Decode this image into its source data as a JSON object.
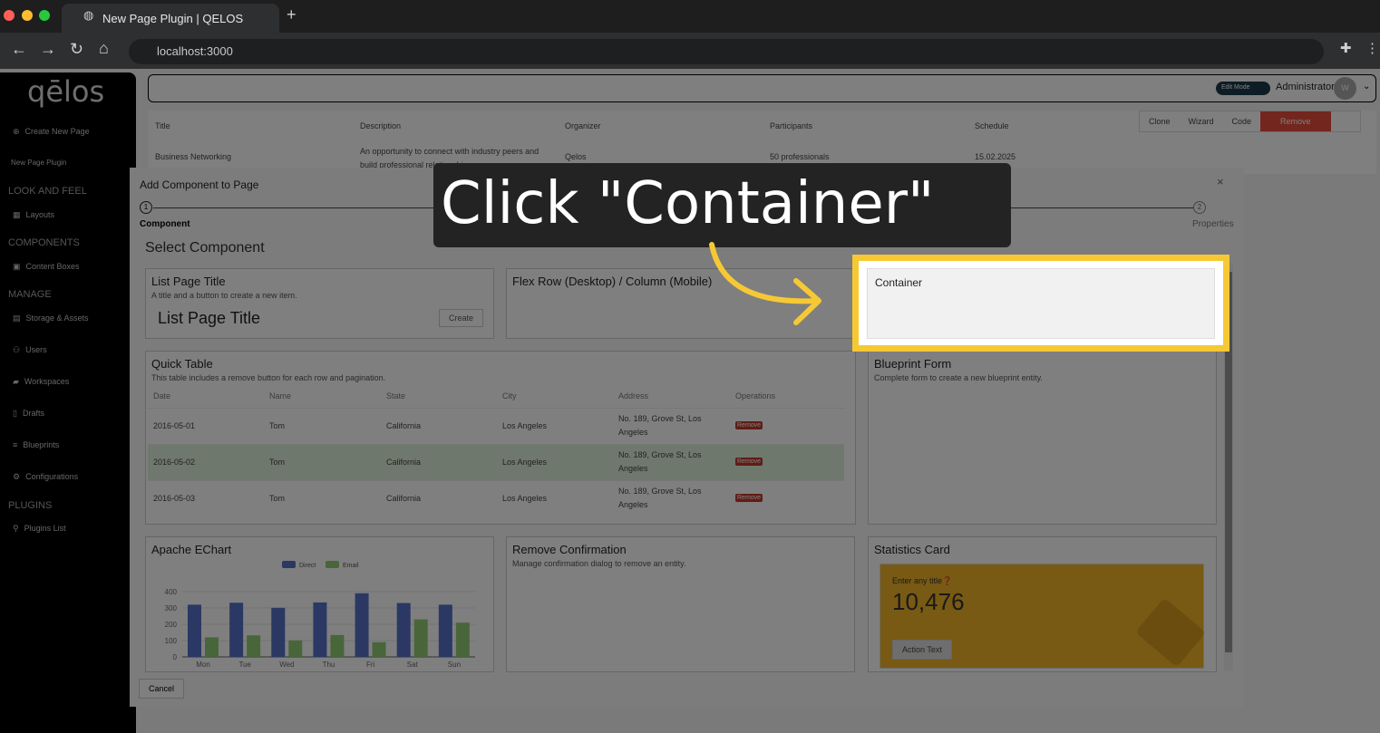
{
  "browser": {
    "tab_title": "New Page Plugin | QELOS",
    "url": "localhost:3000"
  },
  "sidebar": {
    "logo": "qēlos",
    "create": "Create New Page",
    "plugin": "New Page Plugin",
    "sections": [
      {
        "label": "LOOK AND FEEL"
      },
      {
        "label": "COMPONENTS"
      },
      {
        "label": "MANAGE"
      },
      {
        "label": "PLUGINS"
      }
    ],
    "items": [
      {
        "label": "Layouts",
        "icon": "grid-icon"
      },
      {
        "label": "Content Boxes",
        "icon": "box-icon"
      },
      {
        "label": "Storage & Assets",
        "icon": "storage-icon"
      },
      {
        "label": "Users",
        "icon": "users-icon"
      },
      {
        "label": "Workspaces",
        "icon": "briefcase-icon"
      },
      {
        "label": "Drafts",
        "icon": "document-icon"
      },
      {
        "label": "Blueprints",
        "icon": "database-icon"
      },
      {
        "label": "Configurations",
        "icon": "gear-icon"
      },
      {
        "label": "Plugins List",
        "icon": "plug-icon"
      }
    ]
  },
  "header": {
    "edit_mode": "Edit Mode",
    "user": "Administrator",
    "avatar": "W"
  },
  "toolbar": {
    "clone": "Clone",
    "wizard": "Wizard",
    "code": "Code",
    "remove": "Remove"
  },
  "bg_table": {
    "headers": [
      "Title",
      "Description",
      "Organizer",
      "Participants",
      "Schedule"
    ],
    "row": [
      "Business Networking",
      "An opportunity to connect with industry peers and build professional relationships",
      "Qelos",
      "50 professionals",
      "15.02.2025"
    ]
  },
  "modal": {
    "title": "Add Component to Page",
    "step1_num": "1",
    "step1": "Component",
    "step2_num": "2",
    "step2": "Properties",
    "heading": "Select Component",
    "cancel": "Cancel",
    "cards": {
      "list_title": {
        "title": "List Page Title",
        "desc": "A title and a button to create a new item.",
        "preview": "List Page Title",
        "button": "Create"
      },
      "flex": {
        "title": "Flex Row (Desktop) / Column (Mobile)"
      },
      "container": {
        "title": "Container"
      },
      "quick_table": {
        "title": "Quick Table",
        "desc": "This table includes a remove button for each row and pagination.",
        "headers": [
          "Date",
          "Name",
          "State",
          "City",
          "Address",
          "Operations"
        ],
        "rows": [
          [
            "2016-05-01",
            "Tom",
            "California",
            "Los Angeles",
            "No. 189, Grove St, Los Angeles",
            "Remove"
          ],
          [
            "2016-05-02",
            "Tom",
            "California",
            "Los Angeles",
            "No. 189, Grove St, Los Angeles",
            "Remove"
          ],
          [
            "2016-05-03",
            "Tom",
            "California",
            "Los Angeles",
            "No. 189, Grove St, Los Angeles",
            "Remove"
          ]
        ]
      },
      "blueprint": {
        "title": "Blueprint Form",
        "desc": "Complete form to create a new blueprint entity."
      },
      "echart": {
        "title": "Apache EChart"
      },
      "remove_conf": {
        "title": "Remove Confirmation",
        "desc": "Manage confirmation dialog to remove an entity."
      },
      "stats": {
        "title": "Statistics Card",
        "label": "Enter any title",
        "value": "10,476",
        "button": "Action Text",
        "color": "#f0b429"
      }
    }
  },
  "callout": {
    "text": "Click \"Container\"",
    "color": "#f6c934"
  },
  "chart_data": {
    "type": "bar",
    "categories": [
      "Mon",
      "Tue",
      "Wed",
      "Thu",
      "Fri",
      "Sat",
      "Sun"
    ],
    "series": [
      {
        "name": "Direct",
        "values": [
          320,
          332,
          301,
          334,
          390,
          330,
          320
        ],
        "color": "#5470c6"
      },
      {
        "name": "Email",
        "values": [
          120,
          132,
          101,
          134,
          90,
          230,
          210
        ],
        "color": "#91cc75"
      }
    ],
    "yticks": [
      0,
      100,
      200,
      300,
      400
    ],
    "ylim": [
      0,
      400
    ],
    "legend": "top-center",
    "grid": true
  }
}
